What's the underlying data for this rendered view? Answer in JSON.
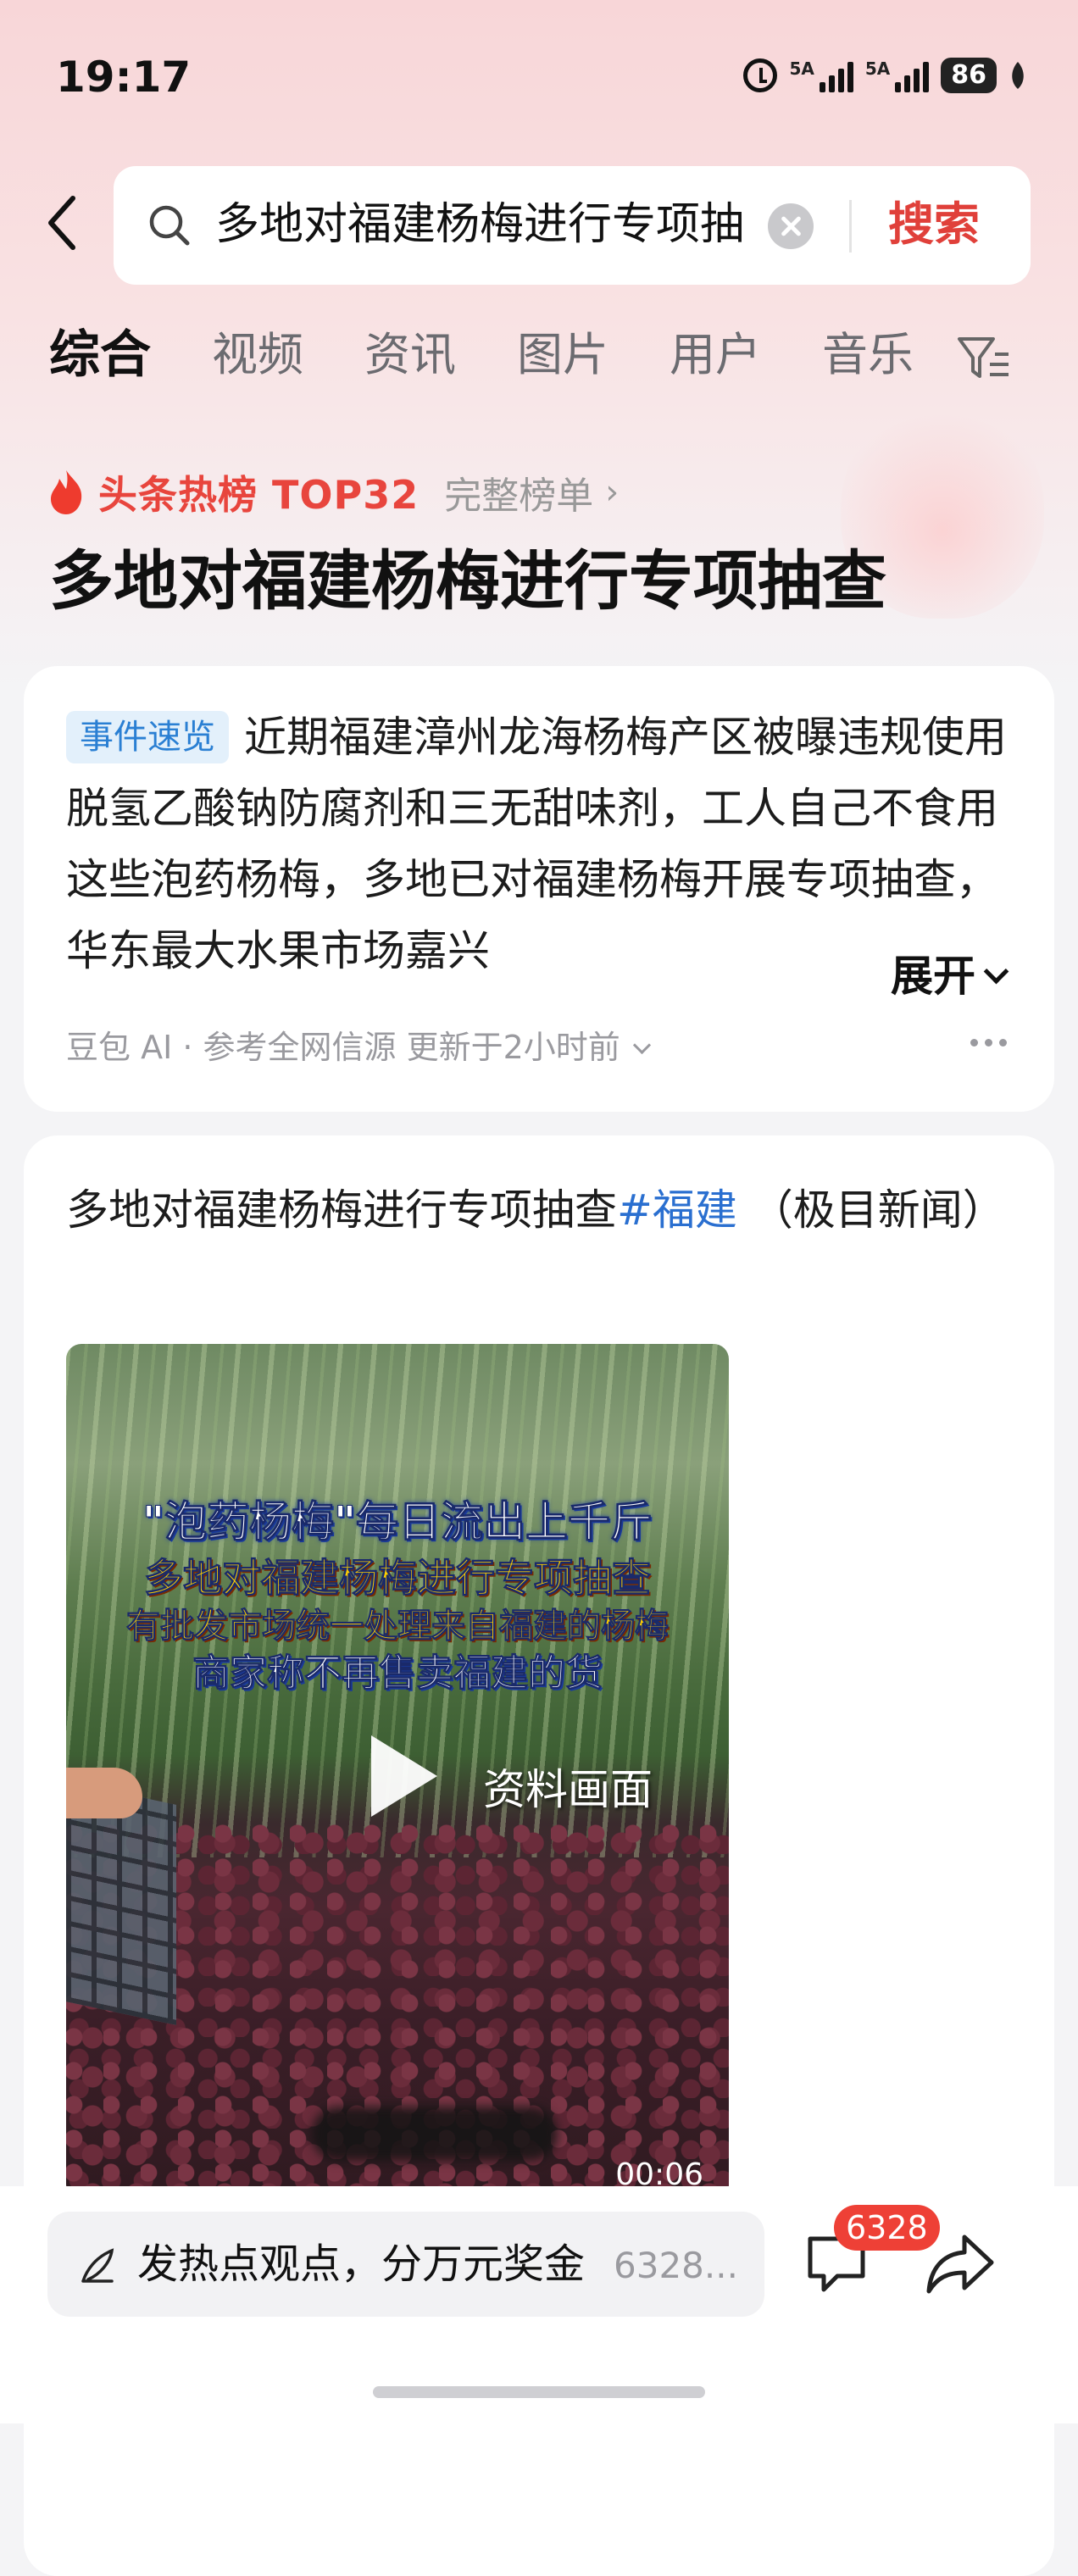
{
  "status_bar": {
    "time": "19:17",
    "signal1": "5A",
    "signal2": "5A",
    "battery": "86"
  },
  "search": {
    "query": "多地对福建杨梅进行专项抽",
    "button": "搜索"
  },
  "tabs": [
    {
      "label": "综合",
      "active": true
    },
    {
      "label": "视频"
    },
    {
      "label": "资讯"
    },
    {
      "label": "图片"
    },
    {
      "label": "用户"
    },
    {
      "label": "音乐"
    }
  ],
  "hot": {
    "label": "头条热榜 TOP32",
    "full_board": "完整榜单",
    "headline": "多地对福建杨梅进行专项抽查"
  },
  "summary_card": {
    "tag": "事件速览",
    "text": "近期福建漳州龙海杨梅产区被曝违规使用脱氢乙酸钠防腐剂和三无甜味剂，工人自己不食用这些泡药杨梅，多地已对福建杨梅开展专项抽查，华东最大水果市场嘉兴",
    "expand": "展开",
    "source": "豆包 AI · 参考全网信源 更新于2小时前"
  },
  "post": {
    "text": "多地对福建杨梅进行专项抽查",
    "hashtag": "#福建",
    "source": "（极目新闻）",
    "video": {
      "line1": "\"泡药杨梅\"每日流出上千斤",
      "line2": "多地对福建杨梅进行专项抽查",
      "line3": "有批发市场统一处理来自福建的杨梅",
      "line4": "商家称不再售卖福建的货",
      "label": "资料画面",
      "duration": "00:06"
    }
  },
  "bottom": {
    "comment_placeholder": "发热点观点，分万元奖金",
    "comment_count_text": "6328...",
    "badge": "6328"
  },
  "colors": {
    "accent": "#e0403a",
    "hashtag": "#2a6fd0",
    "tag_bg": "#e3f0fb"
  }
}
